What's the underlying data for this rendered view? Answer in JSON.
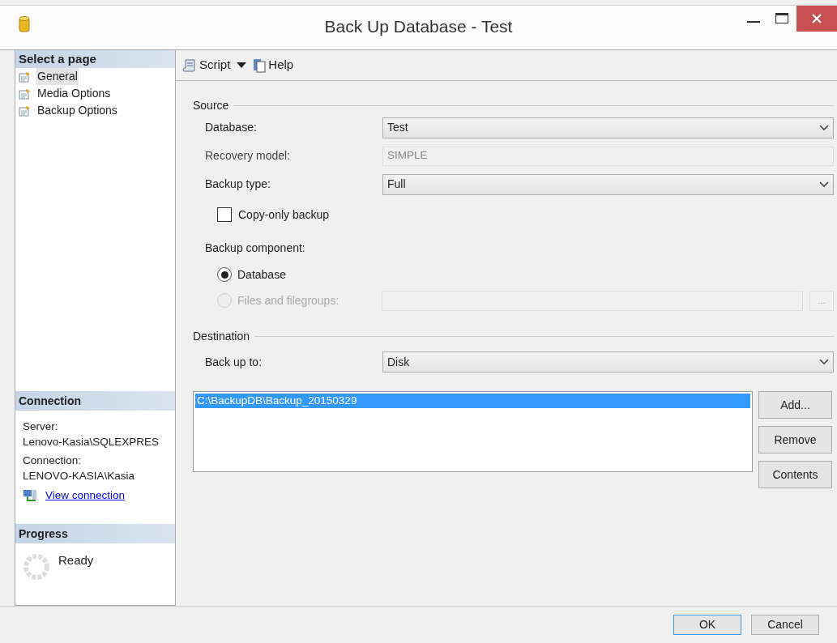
{
  "window": {
    "title": "Back Up Database - Test"
  },
  "sidebar": {
    "header": "Select a page",
    "items": [
      {
        "label": "General",
        "selected": true
      },
      {
        "label": "Media Options",
        "selected": false
      },
      {
        "label": "Backup Options",
        "selected": false
      }
    ]
  },
  "connection": {
    "header": "Connection",
    "server_label": "Server:",
    "server": "Lenovo-Kasia\\SQLEXPRES",
    "connection_label": "Connection:",
    "connection": "LENOVO-KASIA\\Kasia",
    "link": "View connection"
  },
  "progress": {
    "header": "Progress",
    "status": "Ready"
  },
  "toolbar": {
    "script": "Script",
    "help": "Help"
  },
  "source": {
    "title": "Source",
    "fields": [
      {
        "label": "Database:",
        "value": "Test",
        "kind": "dropdown",
        "disabled": false
      },
      {
        "label": "Recovery model:",
        "value": "SIMPLE",
        "kind": "text",
        "disabled": true
      },
      {
        "label": "Backup type:",
        "value": "Full",
        "kind": "dropdown",
        "disabled": false
      }
    ],
    "copy_only": {
      "label": "Copy-only backup",
      "checked": false
    },
    "component_label": "Backup component:",
    "components": [
      {
        "label": "Database",
        "selected": true,
        "disabled": false
      },
      {
        "label": "Files and filegroups:",
        "selected": false,
        "disabled": true
      }
    ],
    "browse": "..."
  },
  "destination": {
    "title": "Destination",
    "label": "Back up to:",
    "value": "Disk",
    "paths": [
      {
        "path": "C:\\BackupDB\\Backup_20150329",
        "selected": true
      }
    ],
    "buttons": [
      "Add...",
      "Remove",
      "Contents"
    ]
  },
  "footer": {
    "buttons": [
      {
        "label": "OK",
        "default": true
      },
      {
        "label": "Cancel",
        "default": false
      }
    ]
  }
}
